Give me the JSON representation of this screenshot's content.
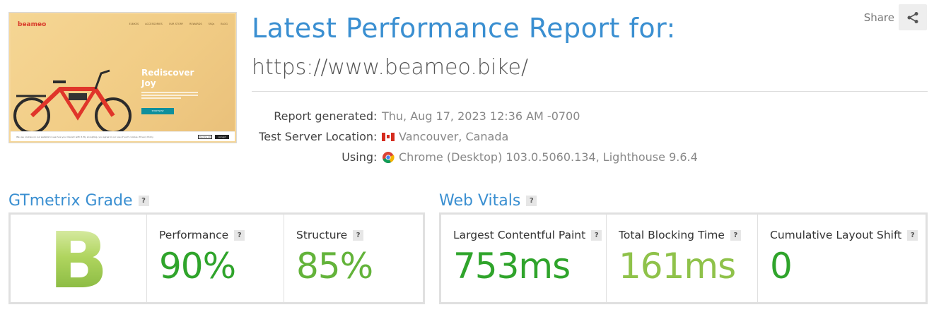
{
  "share": {
    "label": "Share",
    "icon": "share-icon"
  },
  "header": {
    "title": "Latest Performance Report for:",
    "url": "https://www.beameo.bike/"
  },
  "thumbnail": {
    "logo": "beameo",
    "nav": [
      "E-BIKES",
      "ACCESSORIES",
      "OUR STORY",
      "REWARDS",
      "FAQs",
      "BLOG"
    ],
    "hero_line1": "Rediscover",
    "hero_line2": "Joy",
    "shop_button": "SHOP NOW",
    "cookie_text": "We use cookies on our website to see how you interact with it. By accepting, you agree to our use of such cookies. Privacy Policy",
    "cookie_reject": "Decline All",
    "cookie_accept": "Accept"
  },
  "meta": {
    "report_generated": {
      "label": "Report generated",
      "value": "Thu, Aug 17, 2023 12:36 AM -0700"
    },
    "server_location": {
      "label": "Test Server Location",
      "value": "Vancouver, Canada",
      "icon": "canada-flag-icon"
    },
    "using": {
      "label": "Using",
      "value": "Chrome (Desktop) 103.0.5060.134, Lighthouse 9.6.4",
      "icon": "chrome-icon"
    }
  },
  "gtmetrix": {
    "title": "GTmetrix Grade",
    "grade": "B",
    "performance": {
      "label": "Performance",
      "value": "90%",
      "color": "#2fa42b"
    },
    "structure": {
      "label": "Structure",
      "value": "85%",
      "color": "#63b33a"
    }
  },
  "web_vitals": {
    "title": "Web Vitals",
    "lcp": {
      "label": "Largest Contentful Paint",
      "value": "753ms",
      "color": "#2fa42b"
    },
    "tbt": {
      "label": "Total Blocking Time",
      "value": "161ms",
      "color": "#8fc24a"
    },
    "cls": {
      "label": "Cumulative Layout Shift",
      "value": "0",
      "color": "#2fa42b"
    }
  },
  "help_symbol": "?"
}
